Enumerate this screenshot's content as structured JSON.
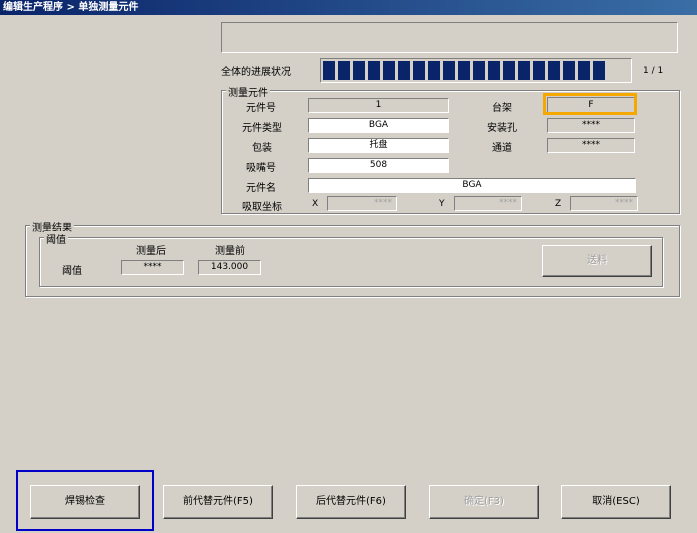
{
  "window": {
    "title": "编辑生产程序 > 单独测量元件"
  },
  "progress": {
    "label": "全体的进展状况",
    "counter": "1 / 1",
    "fraction": 1.0,
    "block_count": 19,
    "color": "#0a246a"
  },
  "measure_component": {
    "group_title": "测量元件",
    "part_no_label": "元件号",
    "part_no": "1",
    "part_type_label": "元件类型",
    "part_type": "BGA",
    "package_label": "包装",
    "package": "托盘",
    "nozzle_label": "吸嘴号",
    "nozzle": "508",
    "part_name_label": "元件名",
    "part_name": "BGA",
    "pickup_label": "吸取坐标",
    "x_label": "X",
    "x_value": "****",
    "y_label": "Y",
    "y_value": "****",
    "z_label": "Z",
    "z_value": "****",
    "table_label": "台架",
    "table": "F",
    "hole_label": "安装孔",
    "hole": "****",
    "lane_label": "通道",
    "lane": "****",
    "highlight_color": "#f5a800"
  },
  "result": {
    "group_title": "测量结果",
    "threshold_group": "阈值",
    "after_label": "测量后",
    "before_label": "测量前",
    "row_label": "阈值",
    "after_value": "****",
    "before_value": "143.000",
    "discard_button": "送料"
  },
  "buttons": {
    "solder_check": "焊锡检查",
    "prev_alt": "前代替元件(F5)",
    "next_alt": "后代替元件(F6)",
    "confirm": "确定(F3)",
    "cancel": "取消(ESC)",
    "focus_color": "#0000c8"
  }
}
